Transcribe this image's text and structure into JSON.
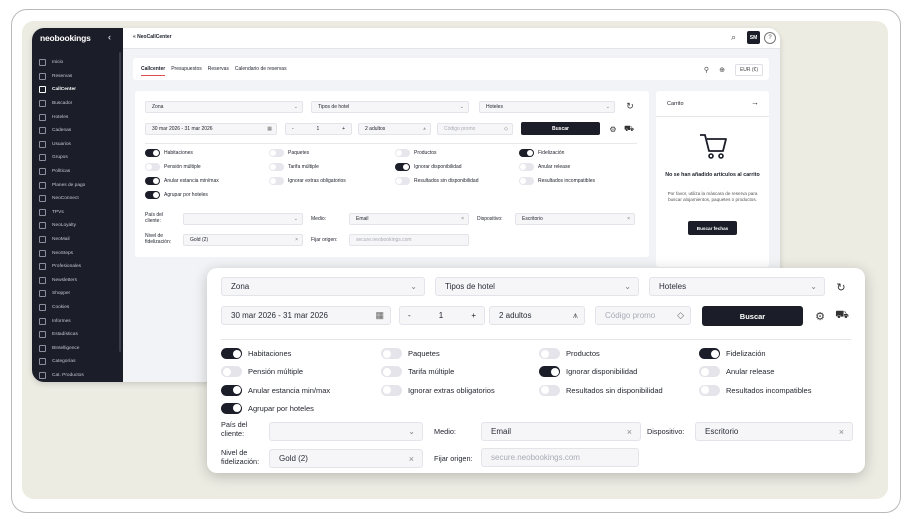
{
  "app": {
    "logo": "neobookings",
    "breadcrumb": "« NeoCallCenter",
    "avatar": "SM",
    "help": "?"
  },
  "sidebar": {
    "items": [
      {
        "label": "Inicio"
      },
      {
        "label": "Reservas"
      },
      {
        "label": "CallCenter",
        "active": true
      },
      {
        "label": "Buscador"
      },
      {
        "label": "Hoteles"
      },
      {
        "label": "Cadenas"
      },
      {
        "label": "Usuarios"
      },
      {
        "label": "Grupos"
      },
      {
        "label": "Políticas"
      },
      {
        "label": "Planes de pago"
      },
      {
        "label": "NeoConnect"
      },
      {
        "label": "TPVs"
      },
      {
        "label": "NeoLoyalty"
      },
      {
        "label": "NeoMail"
      },
      {
        "label": "NeoSteps"
      },
      {
        "label": "Profesionales"
      },
      {
        "label": "Newsletters"
      },
      {
        "label": "Shopper"
      },
      {
        "label": "Cookies"
      },
      {
        "label": "Informes"
      },
      {
        "label": "Estadísticas"
      },
      {
        "label": "BIntelligence"
      },
      {
        "label": "Categorías"
      },
      {
        "label": "Cat. Productos"
      }
    ]
  },
  "tabs": [
    {
      "label": "Callcenter",
      "active": true
    },
    {
      "label": "Presupuestos"
    },
    {
      "label": "Reservas"
    },
    {
      "label": "Calendario de reservas"
    }
  ],
  "currency": "EUR (€)",
  "search": {
    "zona": "Zona",
    "tipos_hotel": "Tipos de hotel",
    "hoteles": "Hoteles",
    "dates": "30 mar 2026 - 31 mar 2026",
    "minus": "-",
    "qty": "1",
    "plus": "+",
    "adults": "2 adultos",
    "promo_placeholder": "Código promo",
    "search_button": "Buscar"
  },
  "options": [
    {
      "label": "Habitaciones",
      "on": true
    },
    {
      "label": "Paquetes",
      "on": false
    },
    {
      "label": "Productos",
      "on": false
    },
    {
      "label": "Fidelización",
      "on": true
    },
    {
      "label": "Pensión múltiple",
      "on": false
    },
    {
      "label": "Tarifa múltiple",
      "on": false
    },
    {
      "label": "Ignorar disponibilidad",
      "on": true
    },
    {
      "label": "Anular release",
      "on": false
    },
    {
      "label": "Anular estancia min/max",
      "on": true
    },
    {
      "label": "Ignorar extras obligatorios",
      "on": false
    },
    {
      "label": "Resultados sin disponibilidad",
      "on": false
    },
    {
      "label": "Resultados incompatibles",
      "on": false
    },
    {
      "label": "Agrupar por hoteles",
      "on": true
    }
  ],
  "fields": {
    "pais_label": "País del cliente:",
    "medio_label": "Medio:",
    "medio_value": "Email",
    "dispositivo_label": "Dispositivo:",
    "dispositivo_value": "Escritorio",
    "nivel_label": "Nivel de fidelización:",
    "nivel_value": "Gold (2)",
    "origen_label": "Fijar origen:",
    "origen_placeholder": "secure.neobookings.com"
  },
  "cart": {
    "title": "Carrito",
    "empty": "No se han añadido artículos al carrito",
    "hint": "Por favor, utiliza la máscara de reserva para buscar alojamientos, paquetes o productos.",
    "button": "Buscar fechas"
  },
  "colors": {
    "dark": "#1b1d28",
    "panel": "#ecece3",
    "accent": "#e34c4c"
  }
}
